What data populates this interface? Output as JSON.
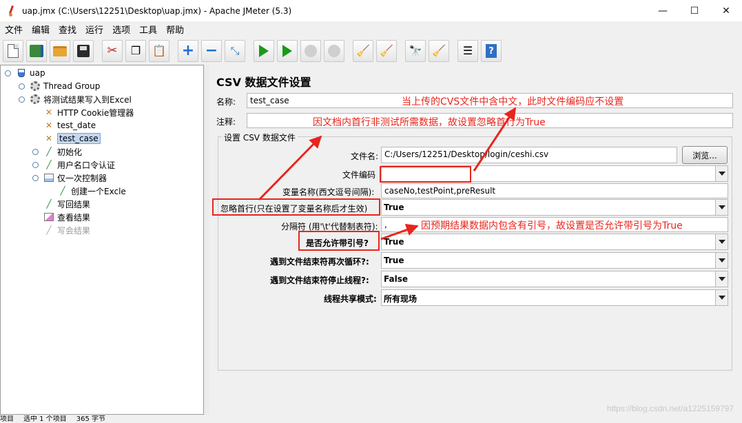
{
  "window": {
    "title": "uap.jmx (C:\\Users\\12251\\Desktop\\uap.jmx) - Apache JMeter (5.3)",
    "minimize": "—",
    "maximize": "☐",
    "close": "✕"
  },
  "menu": [
    "文件",
    "编辑",
    "查找",
    "运行",
    "选项",
    "工具",
    "帮助"
  ],
  "tree": {
    "root": "uap",
    "thread_group": "Thread Group",
    "excel_writer": "将测试结果写入到Excel",
    "cookie_manager": "HTTP Cookie管理器",
    "test_date": "test_date",
    "test_case": "test_case",
    "init": "初始化",
    "auth": "用户名口令认证",
    "once_controller": "仅一次控制器",
    "create_excel": "创建一个Excle",
    "write_back": "写回结果",
    "view_results": "查看结果",
    "write_results": "写会结果"
  },
  "panel": {
    "title": "CSV 数据文件设置",
    "name_label": "名称:",
    "name_value": "test_case",
    "comment_label": "注释:",
    "comment_value": "",
    "group_title": "设置 CSV 数据文件",
    "filename_label": "文件名:",
    "filename_value": "C:/Users/12251/Desktop/login/ceshi.csv",
    "browse_label": "浏览...",
    "encoding_label": "文件编码",
    "encoding_value": "",
    "varnames_label": "变量名称(西文逗号间隔):",
    "varnames_value": "caseNo,testPoint,preResult",
    "ignore_first_label": "忽略首行(只在设置了变量名称后才生效)",
    "ignore_first_value": "True",
    "delimiter_label": "分隔符 (用'\\t'代替制表符):",
    "delimiter_value": ",",
    "quoted_label": "是否允许带引号?",
    "quoted_value": "True",
    "recycle_label": "遇到文件结束符再次循环?:",
    "recycle_value": "True",
    "stop_label": "遇到文件结束符停止线程?:",
    "stop_value": "False",
    "share_label": "线程共享模式:",
    "share_value": "所有现场"
  },
  "annotations": {
    "a1": "当上传的CVS文件中含中文，此时文件编码应不设置",
    "a2": "因文档内首行非测试所需数据，故设置忽略首行为True",
    "a3": "因预期结果数据内包含有引号，故设置是否允许带引号为True",
    "color": "#e8251d"
  },
  "status": {
    "left": "项目",
    "selected": "选中 1 个项目",
    "size": "365 字节"
  },
  "watermark": "https://blog.csdn.net/a1225159797"
}
